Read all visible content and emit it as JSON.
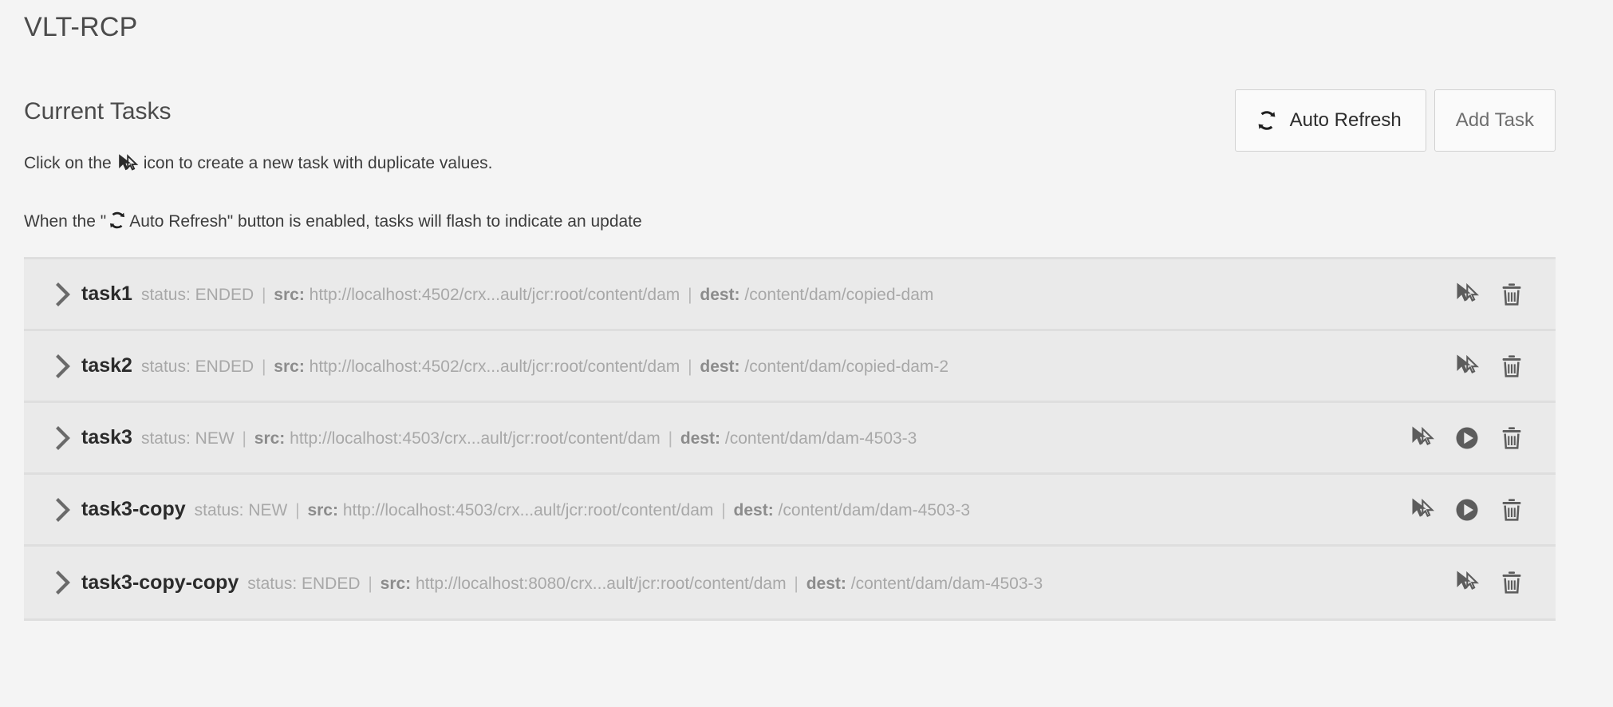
{
  "page": {
    "title": "VLT-RCP"
  },
  "section": {
    "title": "Current Tasks",
    "buttons": {
      "auto_refresh_label": "Auto Refresh",
      "auto_refresh_icon": "refresh-icon",
      "add_task_label": "Add Task"
    }
  },
  "help": {
    "line1_before": "Click on the",
    "line1_icon": "duplicate-cursor-icon",
    "line1_after": "icon to create a new task with duplicate values.",
    "line2_before": "When the \"",
    "line2_icon": "refresh-icon",
    "line2_after": "Auto Refresh\" button is enabled, tasks will flash to indicate an update"
  },
  "labels": {
    "status_key": "status:",
    "src_key": "src:",
    "dest_key": "dest:",
    "separator": "|"
  },
  "colors": {
    "page_background": "#f4f4f4",
    "row_background": "#eaeaea",
    "row_separator": "#dedede",
    "heading_text": "#4b4b4b",
    "task_name_text": "#2b2b2b",
    "meta_text": "#a8a8a8",
    "meta_key_text": "#8c8c8c",
    "icon_color": "#5c5c5c",
    "button_background": "#fafafa",
    "button_border": "#d2d2d2"
  },
  "tasks": [
    {
      "name": "task1",
      "status": "ENDED",
      "src": "http://localhost:4502/crx...ault/jcr:root/content/dam",
      "dest": "/content/dam/copied-dam",
      "expanded": false,
      "actions": [
        "duplicate-cursor-icon",
        "trash-icon"
      ]
    },
    {
      "name": "task2",
      "status": "ENDED",
      "src": "http://localhost:4502/crx...ault/jcr:root/content/dam",
      "dest": "/content/dam/copied-dam-2",
      "expanded": false,
      "actions": [
        "duplicate-cursor-icon",
        "trash-icon"
      ]
    },
    {
      "name": "task3",
      "status": "NEW",
      "src": "http://localhost:4503/crx...ault/jcr:root/content/dam",
      "dest": "/content/dam/dam-4503-3",
      "expanded": false,
      "actions": [
        "duplicate-cursor-icon",
        "play-icon",
        "trash-icon"
      ]
    },
    {
      "name": "task3-copy",
      "status": "NEW",
      "src": "http://localhost:4503/crx...ault/jcr:root/content/dam",
      "dest": "/content/dam/dam-4503-3",
      "expanded": false,
      "actions": [
        "duplicate-cursor-icon",
        "play-icon",
        "trash-icon"
      ]
    },
    {
      "name": "task3-copy-copy",
      "status": "ENDED",
      "src": "http://localhost:8080/crx...ault/jcr:root/content/dam",
      "dest": "/content/dam/dam-4503-3",
      "expanded": false,
      "actions": [
        "duplicate-cursor-icon",
        "trash-icon"
      ]
    }
  ]
}
